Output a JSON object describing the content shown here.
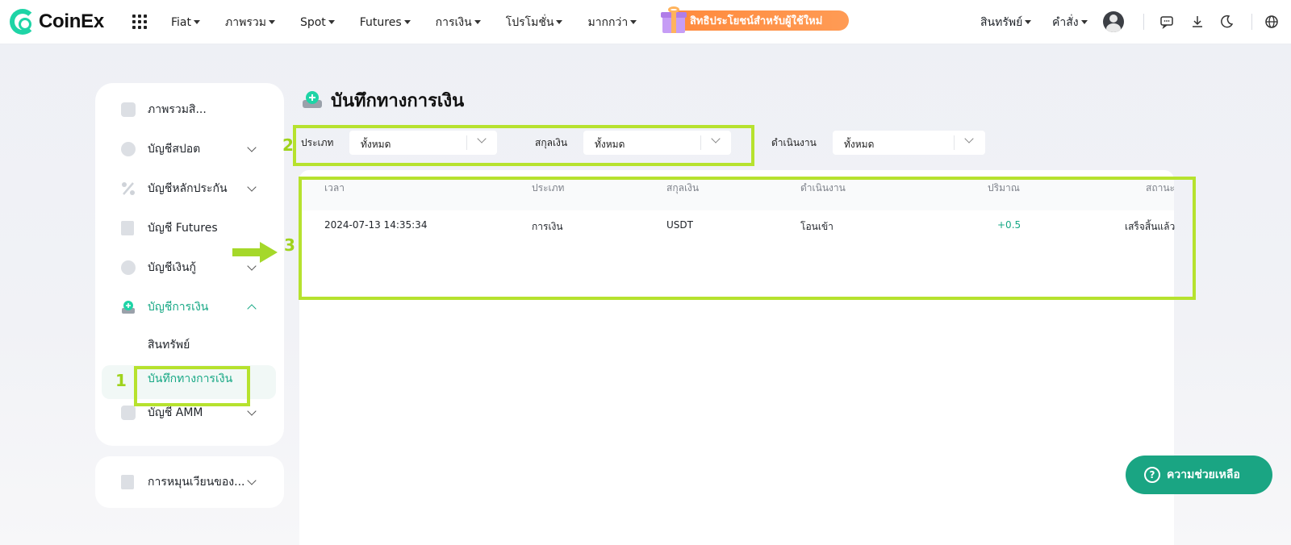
{
  "header": {
    "logo_text": "CoinEx",
    "nav": [
      "Fiat",
      "ภาพรวม",
      "Spot",
      "Futures",
      "การเงิน",
      "โปรโมชั่น",
      "มากกว่า"
    ],
    "promo_label": "สิทธิประโยชน์สำหรับผู้ใช้ใหม่",
    "assets_label": "สินทรัพย์",
    "orders_label": "คำสั่ง"
  },
  "sidebar": {
    "items": [
      {
        "label": "ภาพรวมสิ...",
        "icon": "overview-icon"
      },
      {
        "label": "บัญชีสปอต",
        "icon": "spot-icon"
      },
      {
        "label": "บัญชีหลักประกัน",
        "icon": "margin-icon"
      },
      {
        "label": "บัญชี Futures",
        "icon": "futures-icon"
      },
      {
        "label": "บัญชีเงินกู้",
        "icon": "loan-icon"
      },
      {
        "label": "บัญชีการเงิน",
        "icon": "finance-icon"
      },
      {
        "label": "บัญชี AMM",
        "icon": "amm-icon"
      }
    ],
    "sub_items": [
      "สินทรัพย์",
      "บันทึกทางการเงิน"
    ],
    "bottom_item": "การหมุนเวียนของ..."
  },
  "page": {
    "title": "บันทึกทางการเงิน"
  },
  "filters": {
    "type_label": "ประเภท",
    "type_value": "ทั้งหมด",
    "currency_label": "สกุลเงิน",
    "currency_value": "ทั้งหมด",
    "operation_label": "ดำเนินงาน",
    "operation_value": "ทั้งหมด"
  },
  "table": {
    "headers": [
      "เวลา",
      "ประเภท",
      "สกุลเงิน",
      "ดำเนินงาน",
      "ปริมาณ",
      "สถานะ"
    ],
    "rows": [
      [
        "2024-07-13 14:35:34",
        "การเงิน",
        "USDT",
        "โอนเข้า",
        "+0.5",
        "เสร็จสิ้นแล้ว"
      ]
    ]
  },
  "annotations": [
    "1",
    "2",
    "3"
  ],
  "help_label": "ความช่วยเหลือ",
  "colors": {
    "brand": "#1ed4a6",
    "accent": "#17a885",
    "promo": "#ff8a3c",
    "annotation": "#b6e22e"
  }
}
